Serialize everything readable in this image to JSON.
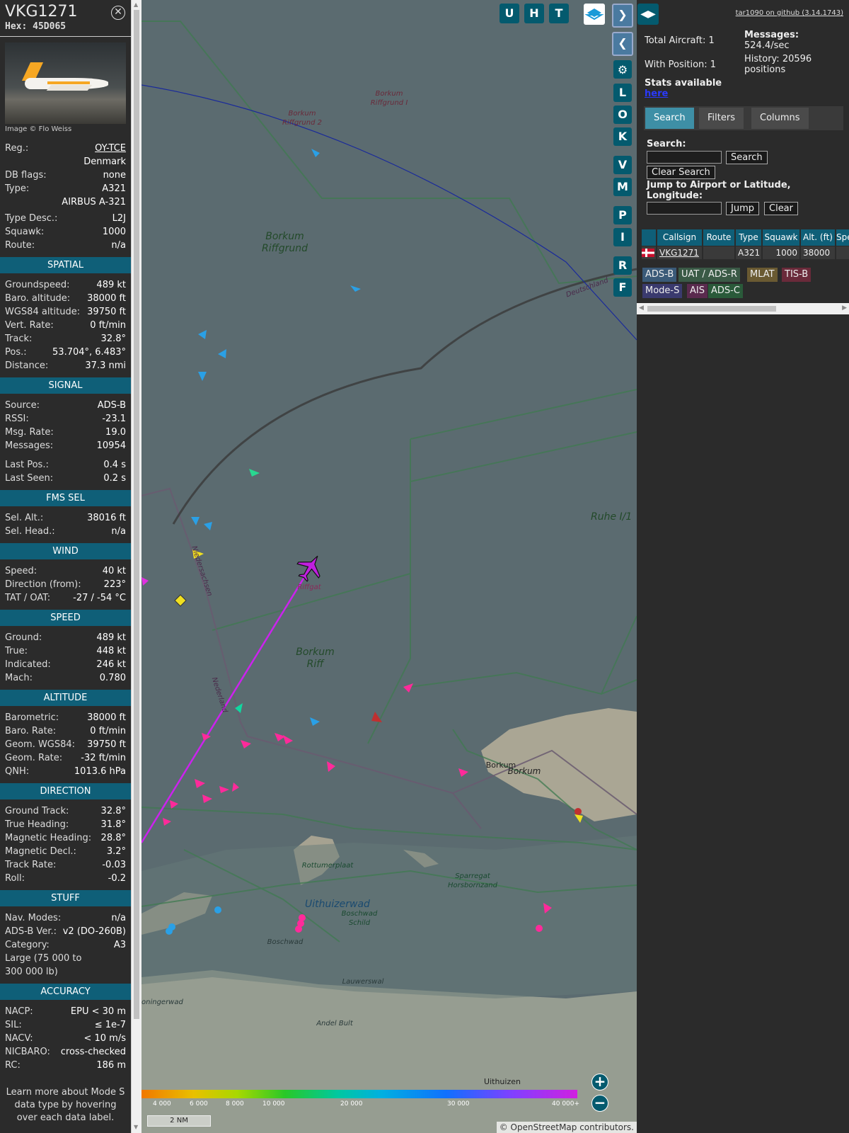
{
  "info": {
    "callsign": "VKG1271",
    "hex_label": "Hex: 45D065",
    "photo_credit": "Image © Flo Weiss",
    "basic": [
      {
        "k": "Reg.:",
        "v": "OY-TCE",
        "link": true
      },
      {
        "k": "",
        "v": "Denmark"
      },
      {
        "k": "DB flags:",
        "v": "none"
      },
      {
        "k": "Type:",
        "v": "A321"
      },
      {
        "k": "",
        "v": "AIRBUS A-321"
      },
      {
        "k": "Type Desc.:",
        "v": "L2J"
      },
      {
        "k": "Squawk:",
        "v": "1000"
      },
      {
        "k": "Route:",
        "v": "n/a"
      }
    ],
    "sections": [
      {
        "title": "SPATIAL",
        "rows": [
          {
            "k": "Groundspeed:",
            "v": "489 kt"
          },
          {
            "k": "Baro. altitude:",
            "v": "38000 ft"
          },
          {
            "k": "WGS84 altitude:",
            "v": "39750 ft"
          },
          {
            "k": "Vert. Rate:",
            "v": "0 ft/min"
          },
          {
            "k": "Track:",
            "v": "32.8°"
          },
          {
            "k": "Pos.:",
            "v": "53.704°, 6.483°"
          },
          {
            "k": "Distance:",
            "v": "37.3 nmi"
          }
        ]
      },
      {
        "title": "SIGNAL",
        "rows": [
          {
            "k": "Source:",
            "v": "ADS-B"
          },
          {
            "k": "RSSI:",
            "v": "-23.1"
          },
          {
            "k": "Msg. Rate:",
            "v": "19.0"
          },
          {
            "k": "Messages:",
            "v": "10954"
          },
          {
            "k": "Last Pos.:",
            "v": "0.4 s",
            "gap": true
          },
          {
            "k": "Last Seen:",
            "v": "0.2 s"
          }
        ]
      },
      {
        "title": "FMS SEL",
        "rows": [
          {
            "k": "Sel. Alt.:",
            "v": "38016 ft"
          },
          {
            "k": "Sel. Head.:",
            "v": "n/a"
          }
        ]
      },
      {
        "title": "WIND",
        "rows": [
          {
            "k": "Speed:",
            "v": "40 kt"
          },
          {
            "k": "Direction (from):",
            "v": "223°"
          },
          {
            "k": "TAT / OAT:",
            "v": "-27 / -54 °C"
          }
        ]
      },
      {
        "title": "SPEED",
        "rows": [
          {
            "k": "Ground:",
            "v": "489 kt"
          },
          {
            "k": "True:",
            "v": "448 kt"
          },
          {
            "k": "Indicated:",
            "v": "246 kt"
          },
          {
            "k": "Mach:",
            "v": "0.780"
          }
        ]
      },
      {
        "title": "ALTITUDE",
        "rows": [
          {
            "k": "Barometric:",
            "v": "38000 ft"
          },
          {
            "k": "Baro. Rate:",
            "v": "0 ft/min"
          },
          {
            "k": "Geom. WGS84:",
            "v": "39750 ft"
          },
          {
            "k": "Geom. Rate:",
            "v": "-32 ft/min"
          },
          {
            "k": "QNH:",
            "v": "1013.6 hPa"
          }
        ]
      },
      {
        "title": "DIRECTION",
        "rows": [
          {
            "k": "Ground Track:",
            "v": "32.8°"
          },
          {
            "k": "True Heading:",
            "v": "31.8°"
          },
          {
            "k": "Magnetic Heading:",
            "v": "28.8°"
          },
          {
            "k": "Magnetic Decl.:",
            "v": "3.2°"
          },
          {
            "k": "Track Rate:",
            "v": "-0.03"
          },
          {
            "k": "Roll:",
            "v": "-0.2"
          }
        ]
      },
      {
        "title": "STUFF",
        "rows": [
          {
            "k": "Nav. Modes:",
            "v": "n/a"
          },
          {
            "k": "ADS-B Ver.:",
            "v": "v2 (DO-260B)"
          },
          {
            "k": "Category:",
            "v": "A3"
          },
          {
            "k": "Large (75 000 to 300 000 lb)",
            "v": ""
          }
        ]
      },
      {
        "title": "ACCURACY",
        "rows": [
          {
            "k": "NACP:",
            "v": "EPU < 30 m"
          },
          {
            "k": "SIL:",
            "v": "≤ 1e-7"
          },
          {
            "k": "NACV:",
            "v": "< 10 m/s"
          },
          {
            "k": "NICBARO:",
            "v": "cross-checked"
          },
          {
            "k": "RC:",
            "v": "186 m"
          }
        ]
      }
    ],
    "footer_note": "Learn more about Mode S data type by hovering over each data label."
  },
  "map": {
    "top_buttons": [
      "U",
      "H",
      "T"
    ],
    "side_buttons": [
      "L",
      "O",
      "K",
      "V",
      "M",
      "P",
      "I",
      "R",
      "F"
    ],
    "labels": {
      "borkum_riffgrund_1": "Borkum Riffgrund I",
      "borkum_riffgrund_2": "Borkum Riffgrund 2",
      "borkum_riffgrund": "Borkum Riffgrund",
      "borkum_riff": "Borkum Riff",
      "borkum_town": "Borkum",
      "borkum_island": "Borkum",
      "uithuizerwad": "Uithuizerwad",
      "boschwad_schild": "Boschwad Schild",
      "rottumerplaat": "Rottumerplaat",
      "sparregat": "Sparregat Horsbornzand",
      "horsbornzand": "Horsbornzand",
      "boschwad": "Boschwad",
      "lauwerswal": "Lauwerswal",
      "andel_bult": "Andel Bult",
      "groningerwad": "oningerwad",
      "uithuizen": "Uithuizen",
      "ruhe": "Ruhe I/1",
      "riffgat": "Riffgat",
      "deutschland": "Deutschland",
      "niedersachsen": "Niedersachsen",
      "nederland": "Nederland"
    },
    "colorbar_ticks": [
      "4 000",
      "6 000",
      "8 000",
      "10 000",
      "20 000",
      "30 000",
      "40 000+"
    ],
    "scale_label": "2 NM",
    "attribution": "© OpenStreetMap contributors."
  },
  "panel": {
    "github_link": "tar1090 on github (3.14.1743)",
    "total_aircraft_label": "Total Aircraft: 1",
    "with_position_label": "With Position: 1",
    "stats_label": "Stats available",
    "stats_link": "here",
    "messages_label": "Messages:",
    "messages_value": "524.4/sec",
    "history_label": "History: 20596 positions",
    "tabs": [
      "Search",
      "Filters",
      "Columns"
    ],
    "search_label": "Search:",
    "search_button": "Search",
    "clear_search_button": "Clear Search",
    "jump_label": "Jump to Airport or Latitude, Longitude:",
    "jump_button": "Jump",
    "clear_button": "Clear",
    "columns": [
      "Callsign",
      "Route",
      "Type",
      "Squawk",
      "Alt. (ft)",
      "Spe"
    ],
    "row": {
      "callsign": "VKG1271",
      "route": "",
      "type": "A321",
      "squawk": "1000",
      "alt": "38000"
    },
    "sources": [
      {
        "label": "ADS-B",
        "bg": "#3a5a78"
      },
      {
        "label": "UAT / ADS-R",
        "bg": "#3a5a46"
      },
      {
        "label": "MLAT",
        "bg": "#6a5a32"
      },
      {
        "label": "TIS-B",
        "bg": "#6a2a3a"
      },
      {
        "label": "Mode-S",
        "bg": "#3a3a6e"
      },
      {
        "label": "AIS",
        "bg": "#5a2a4e"
      },
      {
        "label": "ADS-C",
        "bg": "#2a5a3a"
      }
    ]
  }
}
